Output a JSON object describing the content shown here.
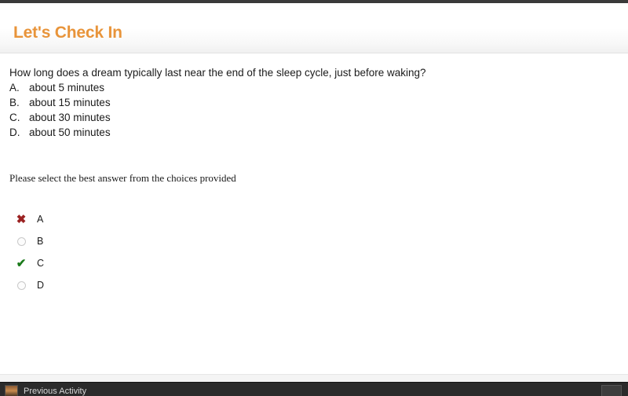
{
  "top_chrome": {
    "ghost_text": "      "
  },
  "header": {
    "title": "Let's Check In",
    "title_color": "#e8943a"
  },
  "question": {
    "stem": "How long does a dream typically last near the end of the sleep cycle, just before waking?",
    "choices": [
      {
        "letter": "A.",
        "text": "about 5 minutes"
      },
      {
        "letter": "B.",
        "text": "about 15 minutes"
      },
      {
        "letter": "C.",
        "text": "about 30 minutes"
      },
      {
        "letter": "D.",
        "text": "about 50 minutes"
      }
    ],
    "instruction": "Please select the best answer from the choices provided"
  },
  "answers": {
    "items": [
      {
        "label": "A",
        "state": "incorrect",
        "icon": "cross-icon",
        "icon_glyph": "✖",
        "color": "#9b2222"
      },
      {
        "label": "B",
        "state": "unselected",
        "icon": "radio-empty-icon",
        "icon_glyph": "",
        "color": "#c9c9c9"
      },
      {
        "label": "C",
        "state": "correct",
        "icon": "check-icon",
        "icon_glyph": "✔",
        "color": "#1a7a1a"
      },
      {
        "label": "D",
        "state": "unselected",
        "icon": "radio-empty-icon",
        "icon_glyph": "",
        "color": "#c9c9c9"
      }
    ]
  },
  "footer": {
    "previous_label": "Previous Activity",
    "next_label": ""
  }
}
